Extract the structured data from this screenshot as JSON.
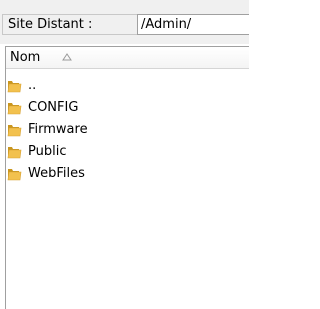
{
  "site": {
    "label": "Site Distant :",
    "path_value": "/Admin/"
  },
  "list": {
    "column_header": "Nom",
    "sort_icon": "sort-ascending-icon",
    "folder_color": "#e3b23c",
    "items": [
      {
        "label": "..",
        "icon": "folder-icon"
      },
      {
        "label": "CONFIG",
        "icon": "folder-icon"
      },
      {
        "label": "Firmware",
        "icon": "folder-icon"
      },
      {
        "label": "Public",
        "icon": "folder-icon"
      },
      {
        "label": "WebFiles",
        "icon": "folder-icon"
      }
    ]
  }
}
